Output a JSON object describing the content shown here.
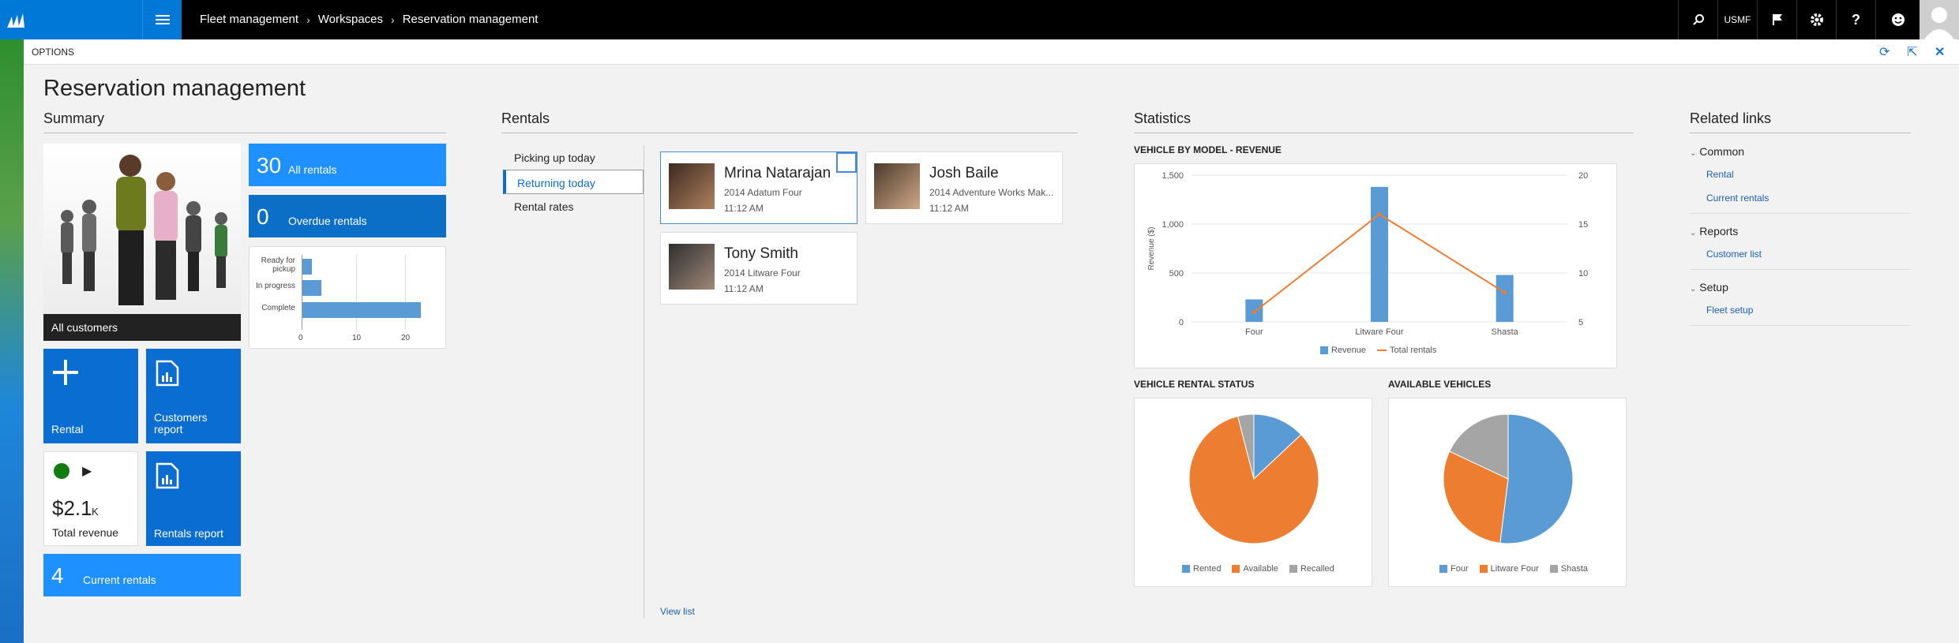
{
  "breadcrumb": [
    "Fleet management",
    "Workspaces",
    "Reservation management"
  ],
  "topbar": {
    "company": "USMF"
  },
  "options_label": "OPTIONS",
  "page_title": "Reservation management",
  "sections": {
    "summary": "Summary",
    "rentals": "Rentals",
    "statistics": "Statistics",
    "related": "Related links"
  },
  "tiles": {
    "all_customers": "All customers",
    "all_rentals": {
      "count": "30",
      "label": "All rentals"
    },
    "overdue_rentals": {
      "count": "0",
      "label": "Overdue rentals"
    },
    "rental": "Rental",
    "customers_report_l1": "Customers",
    "customers_report_l2": "report",
    "total_revenue": {
      "value": "$2.1",
      "unit": "K",
      "label": "Total revenue"
    },
    "rentals_report": "Rentals report",
    "current_rentals": {
      "count": "4",
      "label": "Current rentals"
    }
  },
  "summary_chart": {
    "categories_line1": [
      "Ready for",
      "In progress",
      "Complete"
    ],
    "categories_line2": [
      "pickup",
      "",
      ""
    ],
    "ticks": [
      "0",
      "10",
      "20"
    ]
  },
  "rental_tabs": [
    "Picking up today",
    "Returning today",
    "Rental rates"
  ],
  "rental_cards": [
    {
      "name": "Mrina Natarajan",
      "vehicle": "2014 Adatum Four",
      "time": "11:12 AM"
    },
    {
      "name": "Josh Baile",
      "vehicle": "2014 Adventure Works Mak...",
      "time": "11:12 AM"
    },
    {
      "name": "Tony Smith",
      "vehicle": "2014 Litware Four",
      "time": "11:12 AM"
    }
  ],
  "view_list": "View list",
  "chart_data": [
    {
      "type": "bar",
      "title": "VEHICLE BY MODEL - REVENUE",
      "categories": [
        "Four",
        "Litware Four",
        "Shasta"
      ],
      "series": [
        {
          "name": "Revenue",
          "values": [
            230,
            1380,
            480
          ],
          "color": "#5b9bd5",
          "axis": "left"
        },
        {
          "name": "Total rentals",
          "values": [
            6,
            16,
            8
          ],
          "color": "#ed7d31",
          "axis": "right",
          "type": "line"
        }
      ],
      "ylabel": "Revenue ($)",
      "ylim": [
        0,
        1500
      ],
      "yticks": [
        "0",
        "500",
        "1,000",
        "1,500"
      ],
      "y2lim": [
        5,
        20
      ],
      "y2ticks": [
        "5",
        "10",
        "15",
        "20"
      ]
    },
    {
      "type": "pie",
      "title": "VEHICLE RENTAL STATUS",
      "labels": [
        "Rented",
        "Available",
        "Recalled"
      ],
      "values": [
        13,
        83,
        4
      ],
      "colors": [
        "#5b9bd5",
        "#ed7d31",
        "#a5a5a5"
      ]
    },
    {
      "type": "pie",
      "title": "AVAILABLE VEHICLES",
      "labels": [
        "Four",
        "Litware Four",
        "Shasta"
      ],
      "values": [
        52,
        30,
        18
      ],
      "colors": [
        "#5b9bd5",
        "#ed7d31",
        "#a5a5a5"
      ]
    }
  ],
  "related_links": [
    {
      "group": "Common",
      "links": [
        "Rental",
        "Current rentals"
      ]
    },
    {
      "group": "Reports",
      "links": [
        "Customer list"
      ]
    },
    {
      "group": "Setup",
      "links": [
        "Fleet setup"
      ]
    }
  ]
}
